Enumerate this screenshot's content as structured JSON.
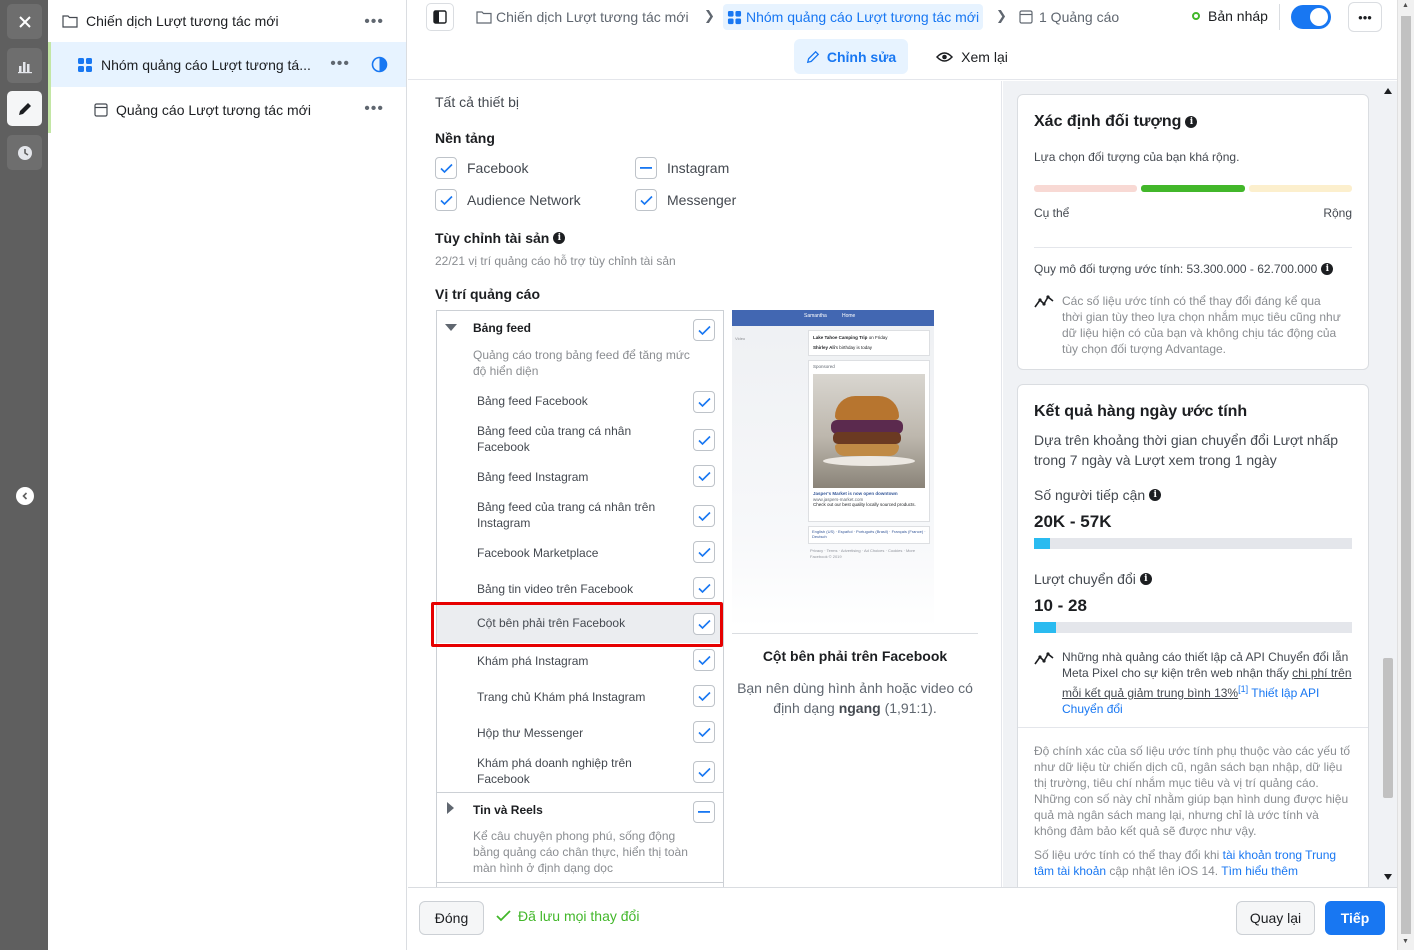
{
  "tree": {
    "campaign": "Chiến dịch Lượt tương tác mới",
    "adset": "Nhóm quảng cáo Lượt tương tá...",
    "ad": "Quảng cáo Lượt tương tác mới"
  },
  "topbar": {
    "crumb_campaign": "Chiến dịch Lượt tương tác mới",
    "crumb_adset": "Nhóm quảng cáo Lượt tương tác mới",
    "crumb_ad": "1 Quảng cáo",
    "status": "Bản nháp",
    "edit_tab": "Chỉnh sửa",
    "review_tab": "Xem lại"
  },
  "editor": {
    "devices_value": "Tất cả thiết bị",
    "platforms_title": "Nền tảng",
    "platforms": [
      {
        "label": "Facebook",
        "state": "checked"
      },
      {
        "label": "Instagram",
        "state": "partial"
      },
      {
        "label": "Audience Network",
        "state": "checked"
      },
      {
        "label": "Messenger",
        "state": "checked"
      }
    ],
    "asset_title": "Tùy chỉnh tài sản",
    "asset_sub": "22/21 vị trí quảng cáo hỗ trợ tùy chỉnh tài sản",
    "placements_title": "Vị trí quảng cáo",
    "feeds_group": {
      "title": "Bảng feed",
      "desc": "Quảng cáo trong bảng feed để tăng mức độ hiển diện"
    },
    "feed_items": [
      "Bảng feed Facebook",
      "Bảng feed của trang cá nhân Facebook",
      "Bảng feed Instagram",
      "Bảng feed của trang cá nhân trên Instagram",
      "Facebook Marketplace",
      "Bảng tin video trên Facebook",
      "Cột bên phải trên Facebook",
      "Khám phá Instagram",
      "Trang chủ Khám phá Instagram",
      "Hộp thư Messenger",
      "Khám phá doanh nghiệp trên Facebook"
    ],
    "stories_group": {
      "title": "Tin và Reels",
      "desc": "Kể câu chuyện phong phú, sống động bằng quảng cáo chân thực, hiển thị toàn màn hình ở định dạng dọc"
    },
    "preview_title": "Cột bên phải trên Facebook",
    "preview_desc_a": "Bạn nên dùng hình ảnh hoặc video có định dạng ",
    "preview_desc_b": "ngang",
    "preview_desc_c": " (1,91:1).",
    "mock": {
      "name": "Samantha",
      "home": "Home",
      "event": "Lake Tahoe Camping Trip",
      "event_when": "on Friday",
      "birthday_name": "Shirley Ali",
      "birthday_text": "'s birthday is today",
      "sponsored": "Sponsored",
      "ad_title": "Jasper's Market is now open downtown",
      "ad_url": "www.jaspers-market.com",
      "ad_text": "Check out our best quality locally sourced products.",
      "langs": "English (US) · Español · Português (Brasil) · Français (France) · Deutsch",
      "footer_links": "Privacy · Terms · Advertising · Ad Choices · Cookies · More",
      "copyright": "Facebook © 2019",
      "left_label": "Video"
    }
  },
  "audience": {
    "title": "Xác định đối tượng",
    "subtitle": "Lựa chọn đối tượng của bạn khá rộng.",
    "left": "Cụ thể",
    "right": "Rộng",
    "size": "Quy mô đối tượng ước tính: 53.300.000 - 62.700.000",
    "note": "Các số liệu ước tính có thể thay đổi đáng kể qua thời gian tùy theo lựa chọn nhắm mục tiêu cũng như dữ liệu hiện có của bạn và không chịu tác động của tùy chọn đối tượng Advantage."
  },
  "daily": {
    "title": "Kết quả hàng ngày ước tính",
    "subtitle": "Dựa trên khoảng thời gian chuyển đổi Lượt nhấp trong 7 ngày và Lượt xem trong 1 ngày",
    "reach_label": "Số người tiếp cận",
    "reach_value": "20K - 57K",
    "reach_fill": 0.05,
    "conv_label": "Lượt chuyển đổi",
    "conv_value": "10 - 28",
    "conv_fill": 0.07,
    "api_note_a": "Những nhà quảng cáo thiết lập cả API Chuyển đổi lẫn Meta Pixel cho sự kiện trên web nhận thấy ",
    "api_note_link": "chi phí trên mỗi kết quả giảm trung bình 13%",
    "api_note_sup": "[1]",
    "api_note_cta": " Thiết lập API Chuyển đổi",
    "accuracy": "Độ chính xác của số liệu ước tính phụ thuộc vào các yếu tố như dữ liệu từ chiến dịch cũ, ngân sách bạn nhập, dữ liệu thị trường, tiêu chí nhắm mục tiêu và vị trí quảng cáo. Những con số này chỉ nhằm giúp bạn hình dung được hiệu quả mà ngân sách mang lại, nhưng chỉ là ước tính và không đảm bảo kết quả sẽ được như vậy.",
    "ios_a": "Số liệu ước tính có thể thay đổi khi ",
    "ios_link": "tài khoản trong Trung tâm tài khoản",
    "ios_b": " cập nhật lên iOS 14. ",
    "ios_more": "Tìm hiểu thêm"
  },
  "footer": {
    "close": "Đóng",
    "saved": "Đã lưu mọi thay đổi",
    "back": "Quay lại",
    "next": "Tiếp"
  },
  "colors": {
    "accent": "#1877f2",
    "highlight": "#e60000",
    "audience_active": "#42b72a"
  }
}
